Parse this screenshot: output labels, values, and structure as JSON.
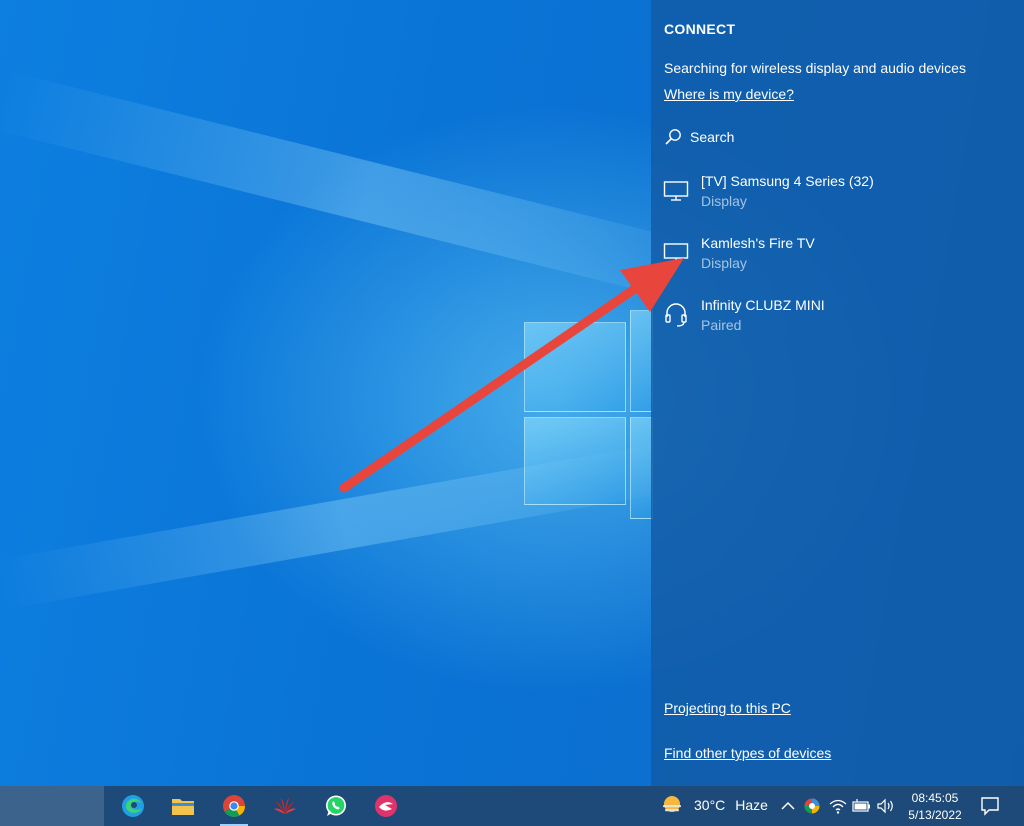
{
  "panel": {
    "title": "CONNECT",
    "status": "Searching for wireless display and audio devices",
    "where_link": "Where is my device?",
    "search_label": "Search",
    "devices": [
      {
        "name": "[TV] Samsung 4 Series (32)",
        "subtitle": "Display",
        "icon": "monitor-icon"
      },
      {
        "name": "Kamlesh's Fire TV",
        "subtitle": "Display",
        "icon": "monitor-icon"
      },
      {
        "name": "Infinity CLUBZ MINI",
        "subtitle": "Paired",
        "icon": "headset-icon"
      }
    ],
    "projecting_link": "Projecting to this PC",
    "find_link": "Find other types of devices"
  },
  "taskbar": {
    "apps": [
      "edge-icon",
      "file-explorer-icon",
      "chrome-icon",
      "huawei-icon",
      "whatsapp-icon",
      "app-icon"
    ],
    "weather": {
      "temp": "30°C",
      "condition": "Haze",
      "icon": "haze-icon"
    },
    "tray_icons": [
      "chevron-up-icon",
      "color-app-icon",
      "wifi-icon",
      "battery-icon",
      "volume-icon"
    ],
    "time": "08:45:05",
    "date": "5/13/2022"
  },
  "colors": {
    "panel_bg": "#125ca8",
    "taskbar_bg": "#1d4a78",
    "arrow": "#e8453c",
    "desktop_blue": "#0a74d6"
  }
}
